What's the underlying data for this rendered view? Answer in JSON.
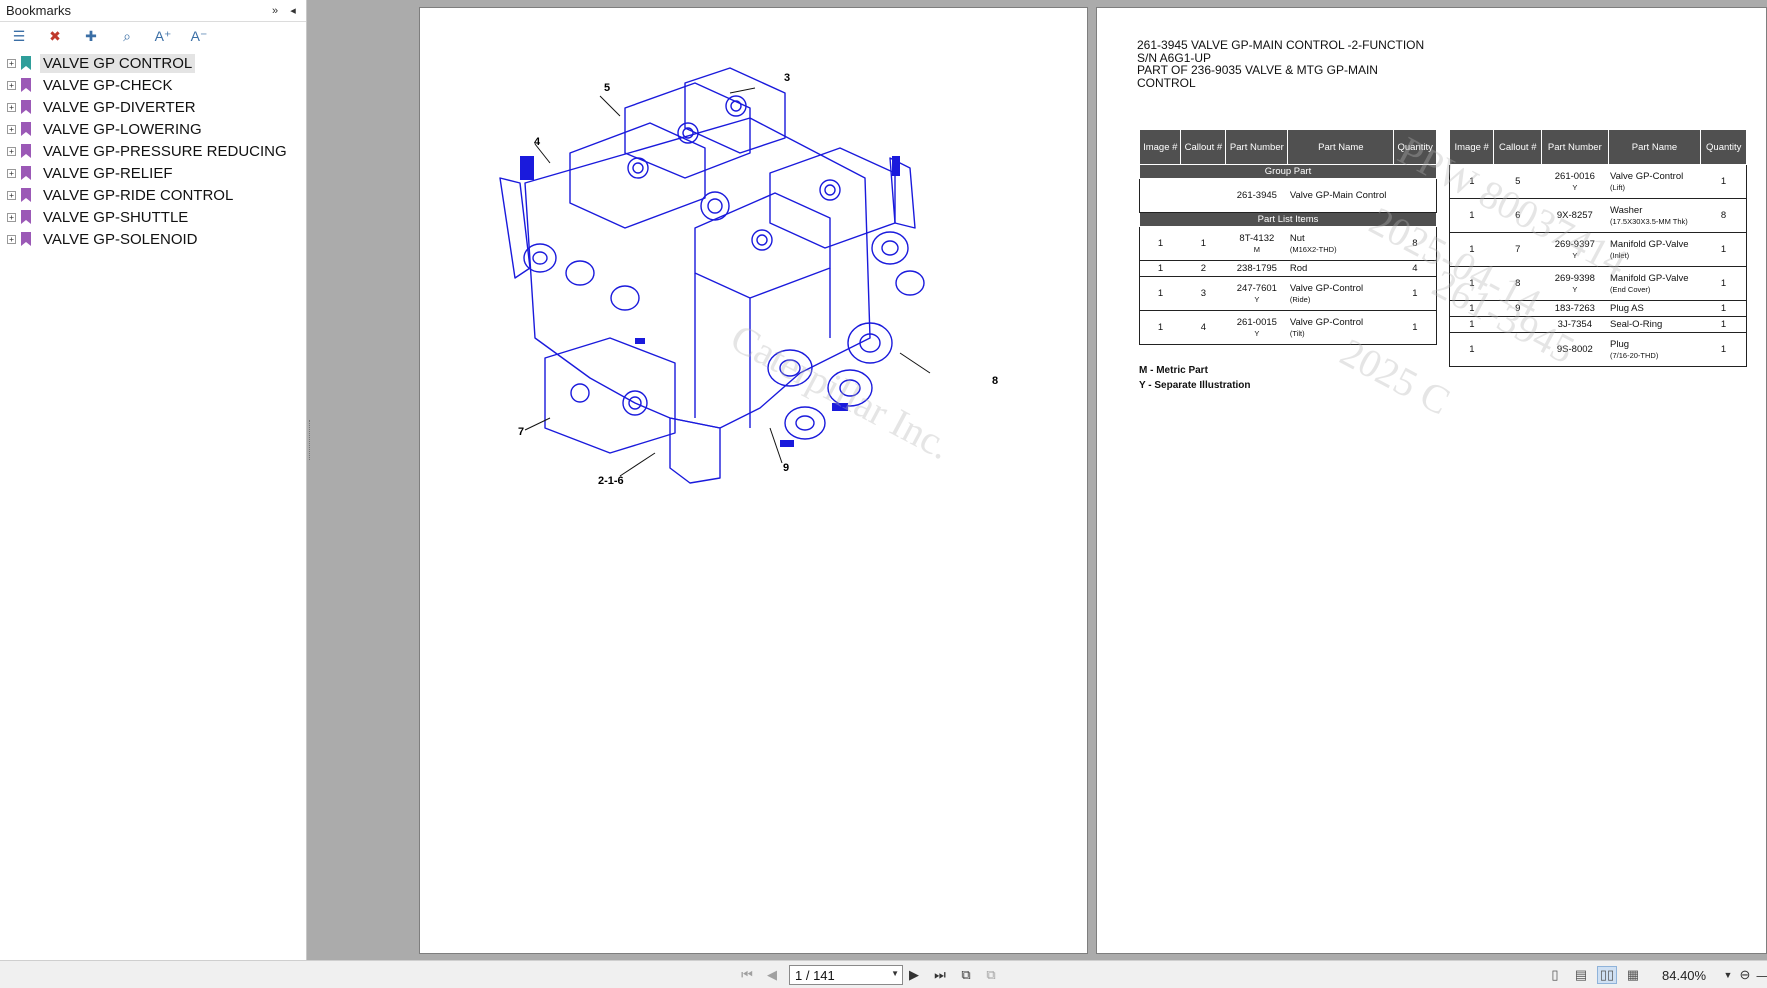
{
  "sidebar": {
    "title": "Bookmarks",
    "header_buttons": [
      "»",
      "◂"
    ],
    "toolbar_icons": [
      "bookmark-options-icon",
      "delete-bookmark-icon",
      "new-bookmark-icon",
      "find-bookmark-icon",
      "increase-text-size-icon",
      "decrease-text-size-icon"
    ],
    "toolbar_glyphs": [
      "☰",
      "✖",
      "✚",
      "⌕",
      "A⁺",
      "A⁻"
    ],
    "items": [
      {
        "label": "VALVE GP CONTROL",
        "color": "#2f9e9a",
        "selected": true
      },
      {
        "label": "VALVE GP-CHECK",
        "color": "#9b59b6"
      },
      {
        "label": "VALVE GP-DIVERTER",
        "color": "#9b59b6"
      },
      {
        "label": "VALVE GP-LOWERING",
        "color": "#9b59b6"
      },
      {
        "label": "VALVE GP-PRESSURE REDUCING",
        "color": "#9b59b6"
      },
      {
        "label": "VALVE GP-RELIEF",
        "color": "#9b59b6"
      },
      {
        "label": "VALVE GP-RIDE CONTROL",
        "color": "#9b59b6"
      },
      {
        "label": "VALVE GP-SHUTTLE",
        "color": "#9b59b6"
      },
      {
        "label": "VALVE GP-SOLENOID",
        "color": "#9b59b6"
      }
    ],
    "expander": "+"
  },
  "illustration": {
    "callouts": [
      "5",
      "3",
      "4",
      "8",
      "7",
      "9",
      "2-1-6"
    ],
    "watermark": "Caterpillar Inc.",
    "line_color": "#1a1adc"
  },
  "parts_page": {
    "title_lines": [
      "261-3945 VALVE GP-MAIN CONTROL -2-FUNCTION",
      "S/N A6G1-UP",
      "PART OF 236-9035 VALVE & MTG GP-MAIN",
      "CONTROL"
    ],
    "headers": [
      "Image #",
      "Callout #",
      "Part Number",
      "Part Name",
      "Quantity"
    ],
    "group_part_label": "Group Part",
    "group_part": {
      "image": "",
      "callout": "",
      "part_number": "261-3945",
      "part_name": "Valve GP-Main Control",
      "quantity": ""
    },
    "part_list_label": "Part List Items",
    "left_rows": [
      {
        "image": "1",
        "callout": "1",
        "part_number": "8T-4132",
        "flag": "M",
        "part_name": "Nut",
        "detail": "(M16X2-THD)",
        "quantity": "8"
      },
      {
        "image": "1",
        "callout": "2",
        "part_number": "238-1795",
        "flag": "",
        "part_name": "Rod",
        "detail": "",
        "quantity": "4"
      },
      {
        "image": "1",
        "callout": "3",
        "part_number": "247-7601",
        "flag": "Y",
        "part_name": "Valve GP-Control",
        "detail": "(Ride)",
        "quantity": "1"
      },
      {
        "image": "1",
        "callout": "4",
        "part_number": "261-0015",
        "flag": "Y",
        "part_name": "Valve GP-Control",
        "detail": "(Tilt)",
        "quantity": "1"
      }
    ],
    "right_rows": [
      {
        "image": "1",
        "callout": "5",
        "part_number": "261-0016",
        "flag": "Y",
        "part_name": "Valve GP-Control",
        "detail": "(Lift)",
        "quantity": "1"
      },
      {
        "image": "1",
        "callout": "6",
        "part_number": "9X-8257",
        "flag": "",
        "part_name": "Washer",
        "detail": "(17.5X30X3.5-MM Thk)",
        "quantity": "8"
      },
      {
        "image": "1",
        "callout": "7",
        "part_number": "269-9397",
        "flag": "Y",
        "part_name": "Manifold GP-Valve",
        "detail": "(Inlet)",
        "quantity": "1"
      },
      {
        "image": "1",
        "callout": "8",
        "part_number": "269-9398",
        "flag": "Y",
        "part_name": "Manifold GP-Valve",
        "detail": "(End Cover)",
        "quantity": "1"
      },
      {
        "image": "1",
        "callout": "9",
        "part_number": "183-7263",
        "flag": "",
        "part_name": "Plug AS",
        "detail": "",
        "quantity": "1"
      },
      {
        "image": "1",
        "callout": "",
        "part_number": "3J-7354",
        "flag": "",
        "part_name": "Seal-O-Ring",
        "detail": "",
        "quantity": "1"
      },
      {
        "image": "1",
        "callout": "",
        "part_number": "9S-8002",
        "flag": "",
        "part_name": "Plug",
        "detail": "(7/16-20-THD)",
        "quantity": "1"
      }
    ],
    "legend": [
      "M - Metric Part",
      "Y - Separate Illustration"
    ],
    "watermark_lines": [
      "PPW 80037414",
      "2025-04-14",
      "261-3945",
      "2025 C"
    ]
  },
  "bottombar": {
    "page_value": "1 / 141",
    "zoom": "84.40%",
    "nav_icons": [
      "first-page-icon",
      "prev-page-icon",
      "next-page-icon",
      "last-page-icon",
      "fit-page-icon",
      "fit-width-icon"
    ],
    "view_icons": [
      "single-page-view-icon",
      "continuous-view-icon",
      "facing-view-icon",
      "continuous-facing-view-icon"
    ]
  }
}
